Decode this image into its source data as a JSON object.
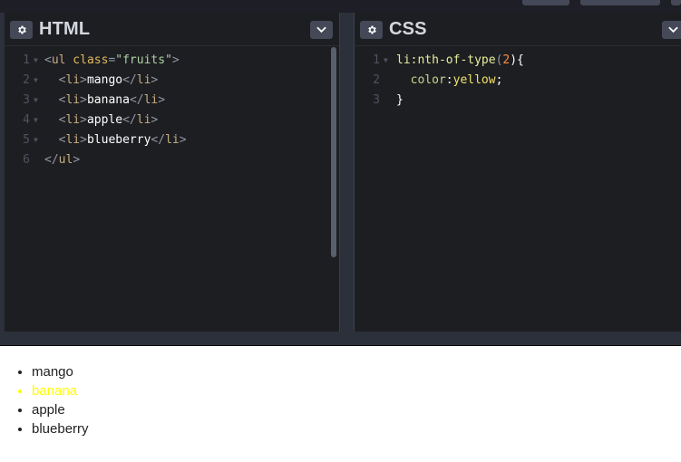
{
  "html_pane": {
    "title": "HTML",
    "gear_icon": "gear-icon",
    "dropdown_icon": "chevron-down-icon",
    "lines": [
      {
        "n": "1",
        "tokens": [
          {
            "t": "<",
            "c": "t-punc"
          },
          {
            "t": "ul",
            "c": "t-tag"
          },
          {
            "t": " class",
            "c": "t-attr"
          },
          {
            "t": "=",
            "c": "t-punc"
          },
          {
            "t": "\"fruits\"",
            "c": "t-str2"
          },
          {
            "t": ">",
            "c": "t-punc"
          }
        ],
        "fold": true
      },
      {
        "n": "2",
        "tokens": [
          {
            "t": "  <",
            "c": "t-punc"
          },
          {
            "t": "li",
            "c": "t-tag"
          },
          {
            "t": ">",
            "c": "t-punc"
          },
          {
            "t": "mango",
            "c": "t-content"
          },
          {
            "t": "</",
            "c": "t-punc"
          },
          {
            "t": "li",
            "c": "t-tag"
          },
          {
            "t": ">",
            "c": "t-punc"
          }
        ],
        "fold": true
      },
      {
        "n": "3",
        "tokens": [
          {
            "t": "  <",
            "c": "t-punc"
          },
          {
            "t": "li",
            "c": "t-tag"
          },
          {
            "t": ">",
            "c": "t-punc"
          },
          {
            "t": "banana",
            "c": "t-content"
          },
          {
            "t": "</",
            "c": "t-punc"
          },
          {
            "t": "li",
            "c": "t-tag"
          },
          {
            "t": ">",
            "c": "t-punc"
          }
        ],
        "fold": true
      },
      {
        "n": "4",
        "tokens": [
          {
            "t": "  <",
            "c": "t-punc"
          },
          {
            "t": "li",
            "c": "t-tag"
          },
          {
            "t": ">",
            "c": "t-punc"
          },
          {
            "t": "apple",
            "c": "t-content"
          },
          {
            "t": "</",
            "c": "t-punc"
          },
          {
            "t": "li",
            "c": "t-tag"
          },
          {
            "t": ">",
            "c": "t-punc"
          }
        ],
        "fold": true
      },
      {
        "n": "5",
        "tokens": [
          {
            "t": "  <",
            "c": "t-punc"
          },
          {
            "t": "li",
            "c": "t-tag"
          },
          {
            "t": ">",
            "c": "t-punc"
          },
          {
            "t": "blueberry",
            "c": "t-content"
          },
          {
            "t": "</",
            "c": "t-punc"
          },
          {
            "t": "li",
            "c": "t-tag"
          },
          {
            "t": ">",
            "c": "t-punc"
          }
        ],
        "fold": true
      },
      {
        "n": "6",
        "tokens": [
          {
            "t": "</",
            "c": "t-punc"
          },
          {
            "t": "ul",
            "c": "t-tag"
          },
          {
            "t": ">",
            "c": "t-punc"
          }
        ],
        "fold": false
      }
    ]
  },
  "css_pane": {
    "title": "CSS",
    "gear_icon": "gear-icon",
    "dropdown_icon": "chevron-down-icon",
    "lines": [
      {
        "n": "1",
        "tokens": [
          {
            "t": "li",
            "c": "t-selector"
          },
          {
            "t": ":nth-of-type",
            "c": "t-selector"
          },
          {
            "t": "(",
            "c": "t-punc"
          },
          {
            "t": "2",
            "c": "t-num"
          },
          {
            "t": "){",
            "c": "t-content"
          }
        ],
        "fold": true
      },
      {
        "n": "2",
        "tokens": [
          {
            "t": "  color",
            "c": "t-prop"
          },
          {
            "t": ":",
            "c": "t-content"
          },
          {
            "t": "yellow",
            "c": "t-val"
          },
          {
            "t": ";",
            "c": "t-content"
          }
        ],
        "fold": false
      },
      {
        "n": "3",
        "tokens": [
          {
            "t": "}",
            "c": "t-content"
          }
        ],
        "fold": false
      }
    ]
  },
  "preview": {
    "items": [
      {
        "label": "mango",
        "highlight": false
      },
      {
        "label": "banana",
        "highlight": true
      },
      {
        "label": "apple",
        "highlight": false
      },
      {
        "label": "blueberry",
        "highlight": false
      }
    ]
  },
  "colors": {
    "editor_bg": "#1d1e22",
    "chrome_bg": "#2c303a",
    "button_bg": "#444857",
    "highlight_text": "#ffff00"
  }
}
